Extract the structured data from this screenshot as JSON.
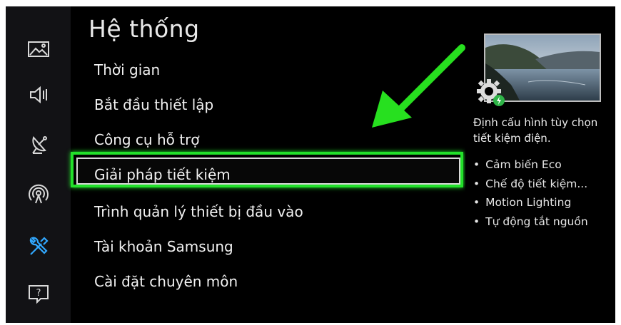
{
  "sidebar": {
    "icons": [
      "picture-icon",
      "sound-icon",
      "broadcast-icon",
      "network-icon",
      "support-tools-icon",
      "help-icon"
    ]
  },
  "menu": {
    "title": "Hệ thống",
    "items": [
      {
        "label": "Thời gian"
      },
      {
        "label": "Bắt đầu thiết lập"
      },
      {
        "label": "Công cụ hỗ trợ"
      },
      {
        "label": "Giải pháp tiết kiệm",
        "selected": true
      },
      {
        "label": "Trình quản lý thiết bị đầu vào"
      },
      {
        "label": "Tài khoản Samsung"
      },
      {
        "label": "Cài đặt chuyên môn"
      }
    ]
  },
  "info": {
    "description": "Định cấu hình tùy chọn tiết kiệm điện.",
    "bullets": [
      "Cảm biến Eco",
      "Chế độ tiết kiệm...",
      "Motion Lighting",
      "Tự động tắt nguồn"
    ]
  },
  "colors": {
    "highlight": "#22e12a",
    "arrow": "#27e01f",
    "background": "#000000",
    "rail": "#121215"
  }
}
